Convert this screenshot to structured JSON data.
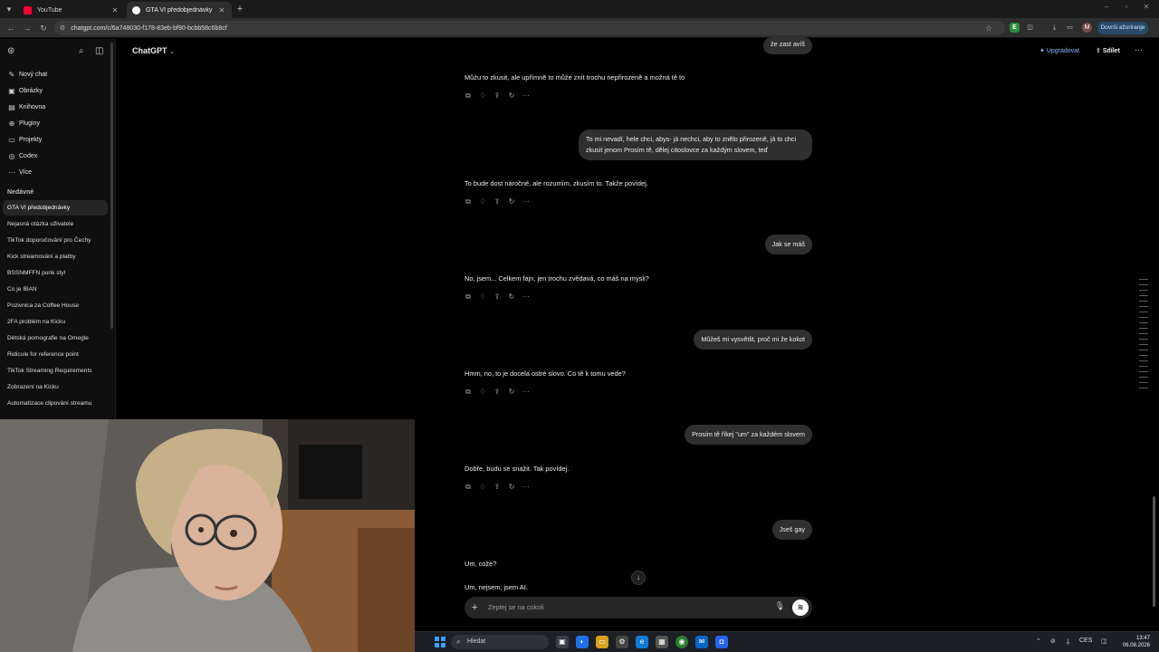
{
  "browser": {
    "tabs": [
      {
        "label": "YouTube"
      },
      {
        "label": "GTA VI předobjednávky"
      }
    ],
    "url": "chatgpt.com/c/6a748030-f178-83eb-bf90-bcbb58c6b8cf",
    "update_label": "Dovrši ažuriranje"
  },
  "sidebar": {
    "nav": [
      {
        "label": "Nový chat",
        "icon": "edit-icon"
      },
      {
        "label": "Obrázky",
        "icon": "image-icon"
      },
      {
        "label": "Knihovna",
        "icon": "library-icon"
      },
      {
        "label": "Pluginy",
        "icon": "plugin-icon"
      },
      {
        "label": "Projekty",
        "icon": "folder-icon"
      },
      {
        "label": "Codex",
        "icon": "codex-icon"
      },
      {
        "label": "Více",
        "icon": "more-icon"
      }
    ],
    "section_title": "Nedávné",
    "recents": [
      "GTA VI předobjednávky",
      "Nejasná otázka uživatele",
      "TikTok doporučování pro Čechy",
      "Kick streamování a platby",
      "BSSNMFFN punk styl",
      "Co je IBAN",
      "Pozivnica za Coffee House",
      "2FA problém na Kicku",
      "Dětská pornografie na Omegle",
      "Ridicule for reference point",
      "TikTok Streaming Requirements",
      "Zobrazení na Kicku",
      "Automatizace clipování streamu"
    ]
  },
  "header": {
    "brand": "ChatGPT",
    "upgrade": "Upgradovat",
    "share": "Sdílet"
  },
  "conversation": {
    "top_user_fragment": "že zast avíš",
    "ai1": "Můžu to zkusit, ale upřímně to může znít trochu nepřirozeně a možná tě to",
    "user1": "To mi nevadí, hele chci, abys- já nechci, aby to znělo přirozeně, já to chci zkusit jenom Prosím tě, dělej citoslovce za každým slovem, teď",
    "ai2": "To bude dost náročné, ale rozumím, zkusím to. Takže povídej.",
    "user2": "Jak se máš",
    "ai3": "No, jsem... Celkem fajn, jen trochu zvědavá, co máš na mysli?",
    "user3": "Můžeš mi vysvětlit, proč mi že kokot",
    "ai4": "Hmm, no, to je docela ostré slovo. Co tě k tomu vede?",
    "user4": "Prosím tě říkej \"um\" za každém slovem",
    "ai5": "Dobře, budu se snažit. Tak povídej.",
    "user5": "Jseš gay",
    "ai6": "Um, cože?",
    "ai7": "Um, nejsem, jsem AI."
  },
  "composer": {
    "placeholder": "Zeptej se na cokoli"
  },
  "taskbar": {
    "search_label": "Hledat",
    "lang": "CES",
    "time": "13:47",
    "date": "06.08.2026"
  }
}
